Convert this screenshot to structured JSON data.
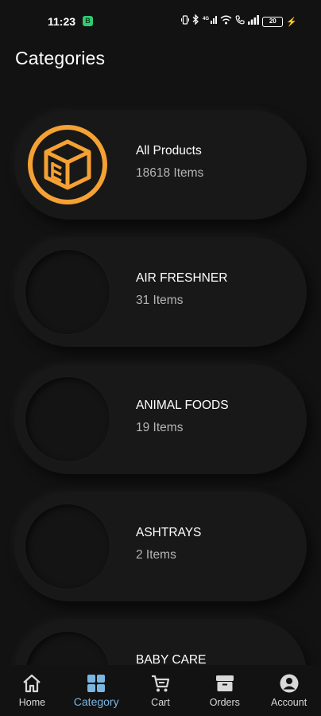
{
  "status_bar": {
    "time": "11:23",
    "app_badge": "B",
    "battery": "20"
  },
  "header": {
    "title": "Categories"
  },
  "categories": [
    {
      "name": "All Products",
      "count": "18618 Items",
      "icon": "box-logo-icon"
    },
    {
      "name": "AIR FRESHNER",
      "count": "31 Items",
      "icon": ""
    },
    {
      "name": "ANIMAL FOODS",
      "count": "19 Items",
      "icon": ""
    },
    {
      "name": "ASHTRAYS",
      "count": "2 Items",
      "icon": ""
    },
    {
      "name": "BABY CARE",
      "count": "",
      "icon": ""
    }
  ],
  "bottom_nav": [
    {
      "label": "Home",
      "icon": "home-icon"
    },
    {
      "label": "Category",
      "icon": "grid-icon",
      "active": true
    },
    {
      "label": "Cart",
      "icon": "cart-icon"
    },
    {
      "label": "Orders",
      "icon": "orders-box-icon"
    },
    {
      "label": "Account",
      "icon": "account-icon"
    }
  ],
  "colors": {
    "background": "#121212",
    "accent_active": "#7ab6e0",
    "logo_orange": "#f5a133"
  }
}
